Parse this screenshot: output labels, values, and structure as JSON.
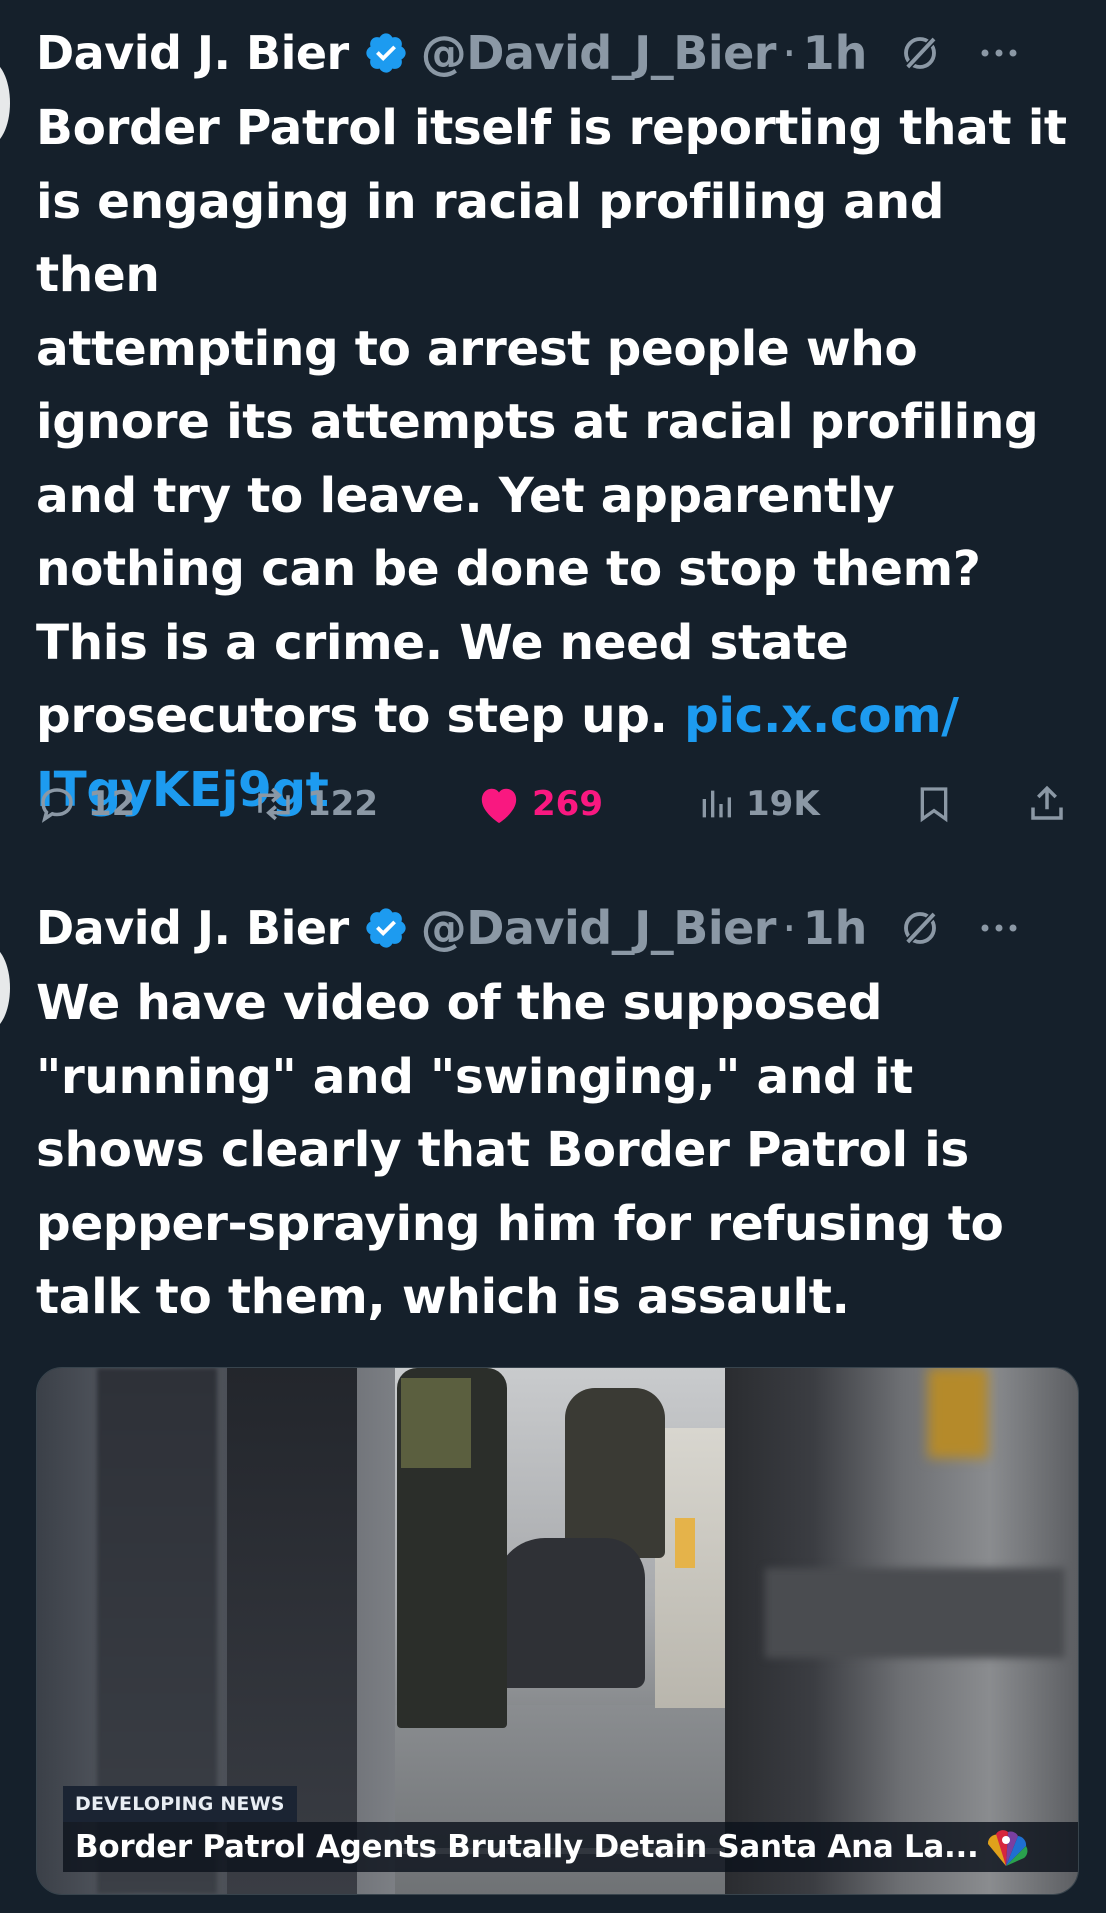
{
  "tweets": [
    {
      "author_name": "David J. Bier",
      "handle": "@David_J_Bier",
      "separator": "·",
      "time": "1h",
      "text": "Border Patrol itself is reporting that it\nis engaging in racial profiling and then\nattempting to arrest people who\nignore its attempts at racial profiling\nand try to leave. Yet apparently\nnothing can be done to stop them?\nThis is a crime. We need state\nprosecutors to step up. ",
      "link": "pic.x.com/\nITgyKEj9gt",
      "actions": {
        "replies": "12",
        "reposts": "122",
        "likes": "269",
        "views": "19K"
      }
    },
    {
      "author_name": "David J. Bier",
      "handle": "@David_J_Bier",
      "separator": "·",
      "time": "1h",
      "text": "We have video of the supposed\n\"running\" and \"swinging,\" and it\nshows clearly that Border Patrol is\npepper-spraying him for refusing to\ntalk to them, which is assault.",
      "media": {
        "news_tag": "DEVELOPING NEWS",
        "caption": "Border Patrol Agents Brutally Detain Santa Ana La..."
      }
    }
  ],
  "colors": {
    "background": "#15202b",
    "accent_blue": "#1d9bf0",
    "like_pink": "#f91880",
    "muted": "#8b98a5"
  },
  "icons": [
    "verified-badge-icon",
    "grok-icon",
    "more-icon",
    "reply-icon",
    "repost-icon",
    "heart-icon",
    "views-icon",
    "bookmark-icon",
    "share-icon",
    "network-logo-icon"
  ]
}
